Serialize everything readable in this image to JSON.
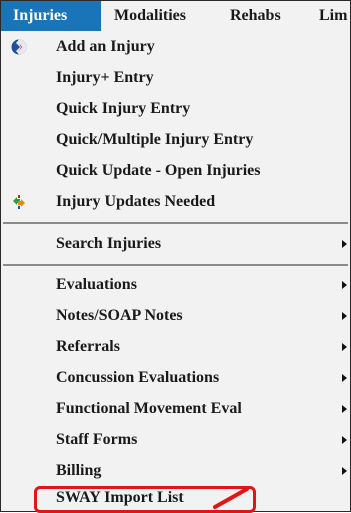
{
  "menubar": {
    "items": [
      "Injuries",
      "Modalities",
      "Rehabs",
      "Lim"
    ]
  },
  "colors": {
    "active": "#1a74b8",
    "highlight": "#e01515"
  },
  "menu": {
    "items": [
      {
        "label": "Add an Injury",
        "icon": "globe-icon",
        "submenu": false
      },
      {
        "label": "Injury+ Entry",
        "submenu": false
      },
      {
        "label": "Quick Injury Entry",
        "submenu": false
      },
      {
        "label": "Quick/Multiple Injury Entry",
        "submenu": false
      },
      {
        "label": "Quick Update - Open Injuries",
        "submenu": false
      },
      {
        "label": "Injury Updates Needed",
        "icon": "updates-icon",
        "submenu": false
      },
      {
        "label": "Search Injuries",
        "submenu": true
      },
      {
        "label": "Evaluations",
        "submenu": true
      },
      {
        "label": "Notes/SOAP Notes",
        "submenu": true
      },
      {
        "label": "Referrals",
        "submenu": true
      },
      {
        "label": "Concussion Evaluations",
        "submenu": true
      },
      {
        "label": "Functional Movement Eval",
        "submenu": true
      },
      {
        "label": "Staff Forms",
        "submenu": true
      },
      {
        "label": "Billing",
        "submenu": true
      },
      {
        "label": "SWAY Import List",
        "submenu": false,
        "highlighted": true
      }
    ]
  }
}
